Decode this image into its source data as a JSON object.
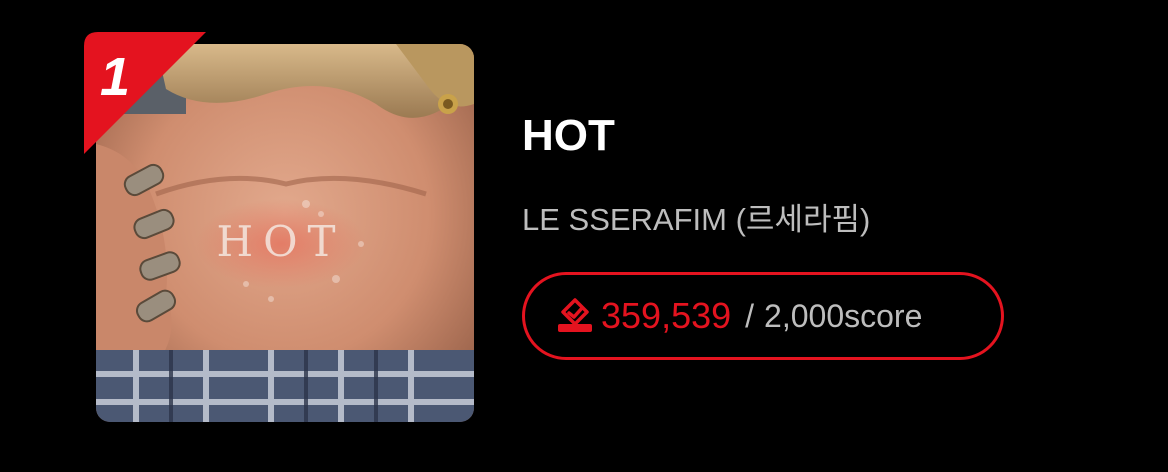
{
  "rank": "1",
  "song": {
    "title": "HOT",
    "artist": "LE SSERAFIM (르세라핌)"
  },
  "cover": {
    "text": "HOT"
  },
  "score": {
    "votes": "359,539",
    "separator": "/",
    "total": "2,000score",
    "icon": "vote-icon"
  },
  "colors": {
    "accent": "#e4131f",
    "background": "#000000",
    "title": "#ffffff",
    "secondary": "#bdbdbd"
  }
}
